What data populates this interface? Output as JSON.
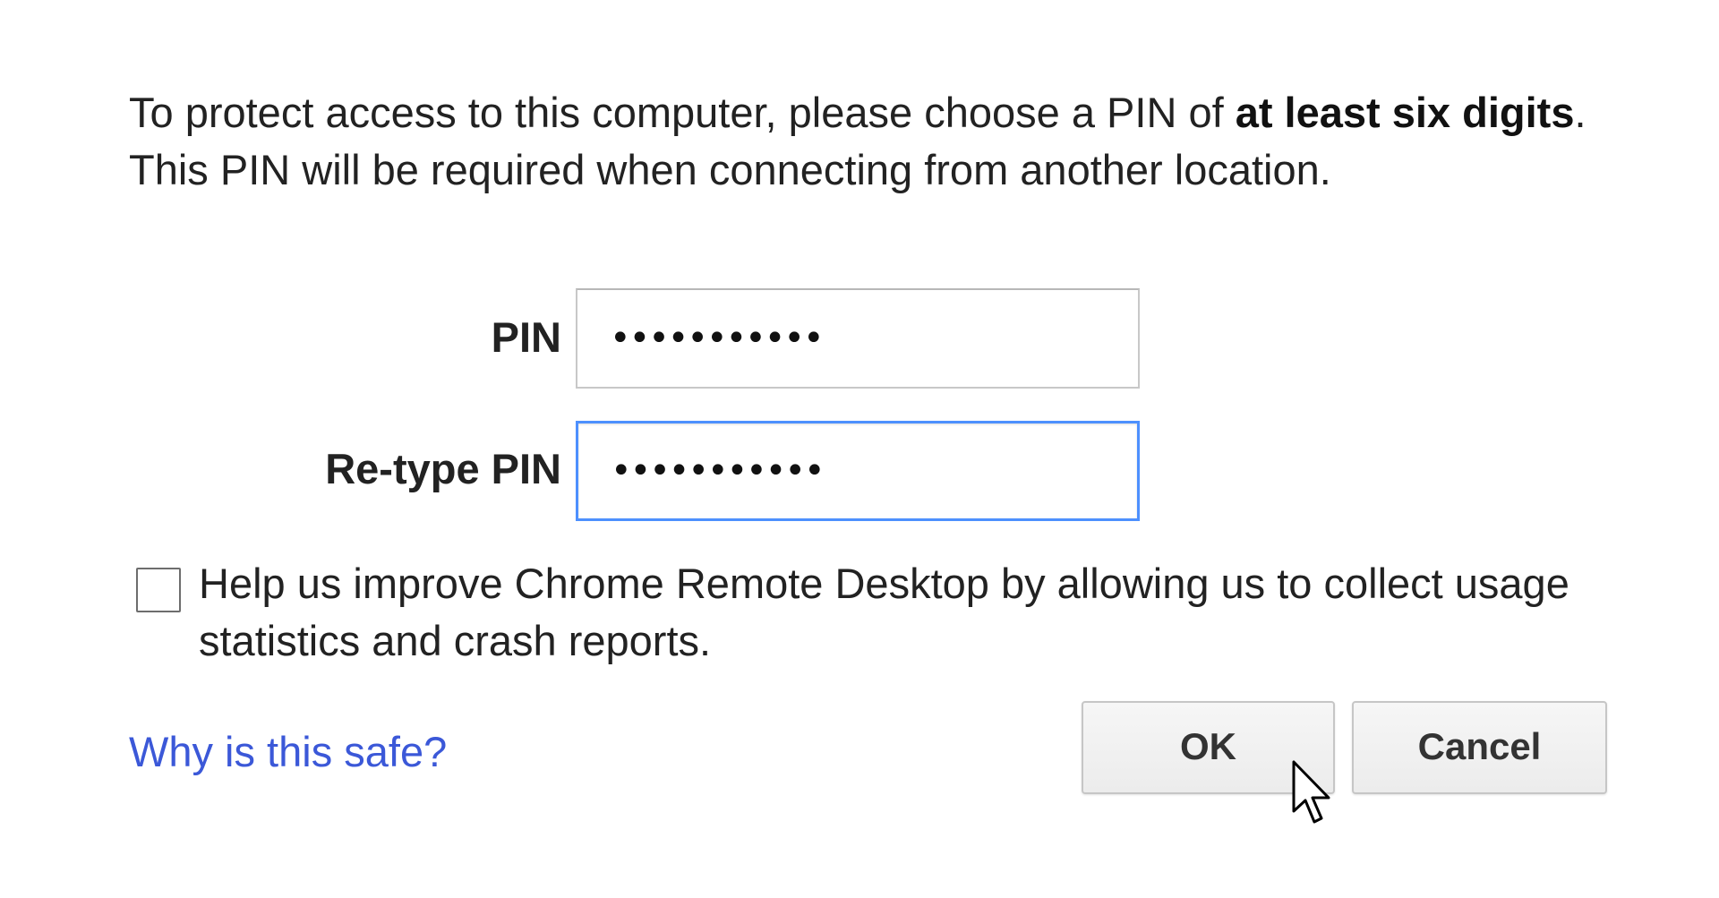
{
  "dialog": {
    "intro": {
      "part1": "To protect access to this computer, please choose a PIN of ",
      "bold": "at least six digits",
      "part2": ". This PIN will be required when connecting from another location."
    },
    "pin": {
      "label": "PIN",
      "value": "•••••••••••"
    },
    "retype_pin": {
      "label": "Re-type PIN",
      "value": "•••••••••••"
    },
    "consent": {
      "checked": false,
      "text": "Help us improve Chrome Remote Desktop by allowing us to collect usage statistics and crash reports."
    },
    "why_link": "Why is this safe?",
    "ok_label": "OK",
    "cancel_label": "Cancel"
  },
  "colors": {
    "link": "#3b58d8",
    "focus_border": "#4d90fe",
    "text": "#222222"
  },
  "icons": {
    "cursor": "mouse-pointer-icon"
  }
}
